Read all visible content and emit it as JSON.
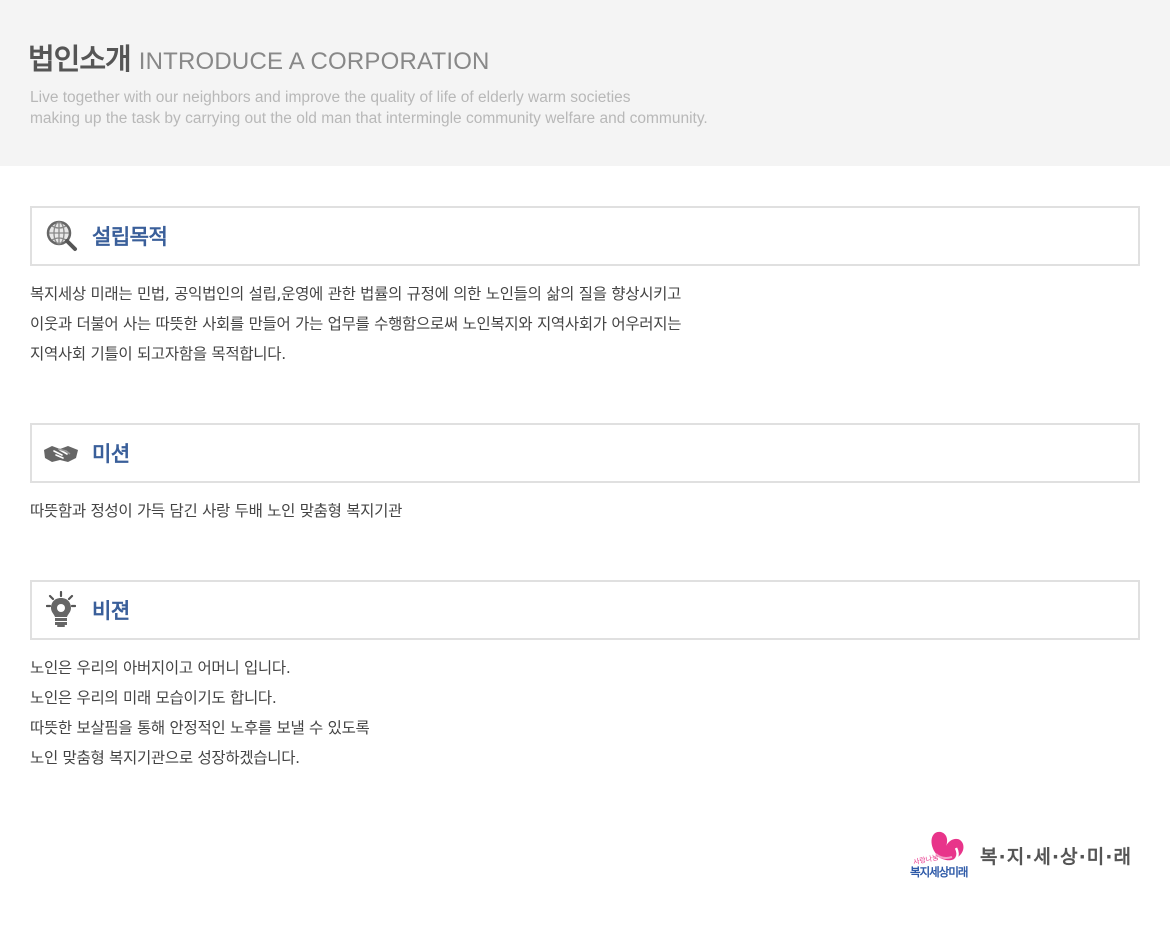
{
  "header": {
    "title_ko": "법인소개",
    "title_en": "INTRODUCE A CORPORATION",
    "subtitle_lines": [
      "Live together with our neighbors and improve the quality of life of elderly warm societies",
      "making up the task by carrying out the old man that intermingle community welfare and community."
    ]
  },
  "sections": [
    {
      "icon": "magnifier-globe-icon",
      "title": "설립목적",
      "lines": [
        "복지세상 미래는 민법, 공익법인의 설립,운영에 관한 법률의 규정에 의한 노인들의 삶의 질을 향상시키고",
        "이웃과 더불어 사는 따뜻한 사회를 만들어 가는 업무를 수행함으로써 노인복지와 지역사회가 어우러지는",
        "지역사회 기틀이  되고자함을 목적합니다."
      ]
    },
    {
      "icon": "handshake-icon",
      "title": "미션",
      "lines": [
        "따뜻함과 정성이 가득 담긴 사랑 두배 노인 맞춤형 복지기관"
      ]
    },
    {
      "icon": "lightbulb-icon",
      "title": "비젼",
      "lines": [
        "노인은 우리의 아버지이고 어머니 입니다.",
        "노인은 우리의 미래 모습이기도 합니다.",
        "따뜻한 보살핌을 통해 안정적인 노후를 보낼 수 있도록",
        "노인 맞춤형 복지기관으로 성장하겠습니다."
      ]
    }
  ],
  "footer": {
    "logo_small_text": "복지세상미래",
    "logo_tagline": "사랑나눔",
    "logo_text": "복·지·세·상·미·래",
    "colors": {
      "logo_pink": "#e8348a",
      "logo_blue": "#2e5aa8"
    }
  },
  "colors": {
    "hero_bg": "#f4f4f4",
    "section_title": "#3a5f9a",
    "box_border": "#e0e0e0"
  }
}
